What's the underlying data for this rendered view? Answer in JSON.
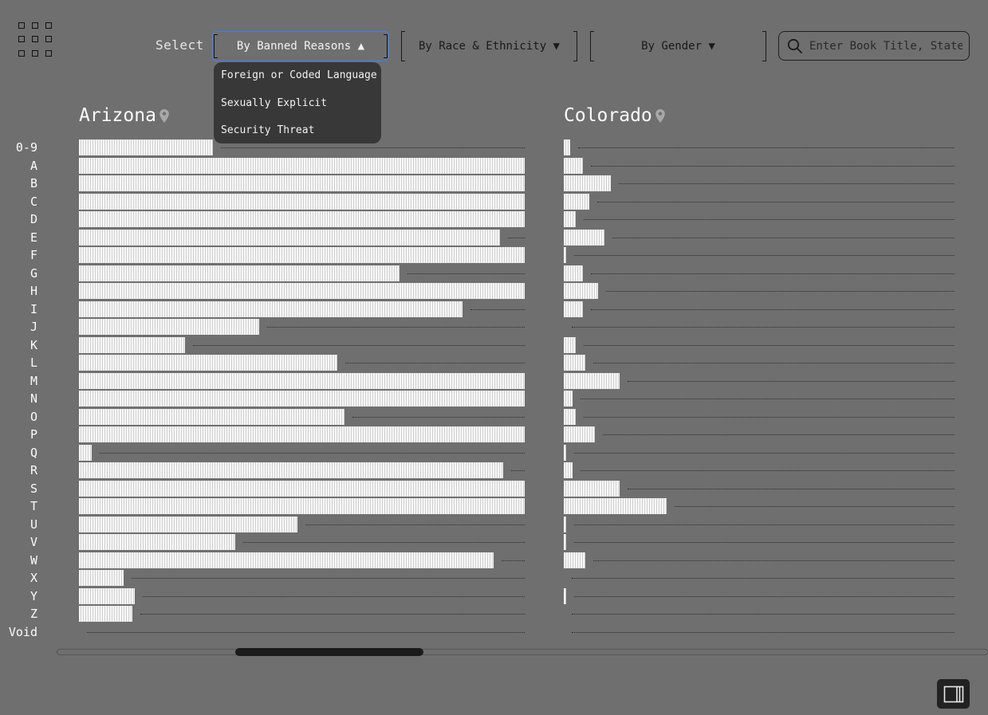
{
  "header": {
    "select_label": "Select",
    "banned_reasons_label": "By Banned Reasons ▲",
    "race_label": "By Race & Ethnicity ▼",
    "gender_label": "By Gender ▼",
    "search_placeholder": "Enter Book Title, State"
  },
  "dropdown_menu": {
    "items": [
      "Foreign or Coded Language",
      "Sexually Explicit",
      "Security Threat"
    ]
  },
  "row_labels": [
    "0-9",
    "A",
    "B",
    "C",
    "D",
    "E",
    "F",
    "G",
    "H",
    "I",
    "J",
    "K",
    "L",
    "M",
    "N",
    "O",
    "P",
    "Q",
    "R",
    "S",
    "T",
    "U",
    "V",
    "W",
    "X",
    "Y",
    "Z",
    "Void"
  ],
  "states": [
    {
      "name": "Arizona",
      "fill": [
        0.3,
        1,
        1,
        1,
        1,
        0.945,
        1,
        0.72,
        1,
        0.86,
        0.405,
        0.238,
        0.58,
        1,
        1,
        0.595,
        1,
        0.028,
        0.952,
        1,
        1,
        0.49,
        0.35,
        0.93,
        0.1,
        0.125,
        0.12,
        0
      ]
    },
    {
      "name": "Colorado",
      "fill": [
        0.016,
        0.049,
        0.12,
        0.065,
        0.03,
        0.104,
        0.006,
        0.049,
        0.088,
        0.048,
        0,
        0.03,
        0.055,
        0.143,
        0.023,
        0.03,
        0.08,
        0.006,
        0.023,
        0.143,
        0.263,
        0.006,
        0.006,
        0.055,
        0,
        0.006,
        0,
        0
      ]
    }
  ],
  "icons": {
    "grid": "grid-menu-icon",
    "pin": "location-pin-icon",
    "search": "search-icon",
    "panel": "side-panel-icon"
  }
}
